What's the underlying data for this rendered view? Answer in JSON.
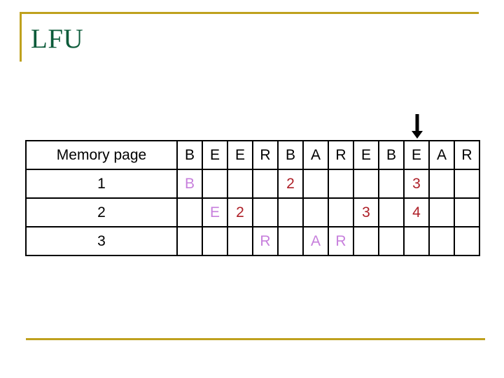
{
  "slide": {
    "title": "LFU",
    "accent_color": "#BFA11E",
    "title_color": "#0C5B3A",
    "reference_color": "#C77FDC",
    "count_color": "#AE1F27",
    "grid_color": "#000000",
    "background_color": "#FFFFFF"
  },
  "annotation": {
    "arrow_icon": "arrow-down-icon",
    "arrow_target_column_index": 9,
    "arrow_target_label": "E"
  },
  "table": {
    "row_label_header": "Memory page",
    "reference_string": [
      "B",
      "E",
      "E",
      "R",
      "B",
      "A",
      "R",
      "E",
      "B",
      "E",
      "A",
      "R"
    ],
    "rows": [
      {
        "label": "1",
        "cells": [
          "B",
          "",
          "",
          "",
          "2",
          "",
          "",
          "",
          "",
          "3",
          "",
          ""
        ],
        "kinds": [
          "ref",
          "empty",
          "empty",
          "empty",
          "count",
          "empty",
          "empty",
          "empty",
          "empty",
          "count",
          "empty",
          "empty"
        ]
      },
      {
        "label": "2",
        "cells": [
          "",
          "E",
          "2",
          "",
          "",
          "",
          "",
          "3",
          "",
          "4",
          "",
          ""
        ],
        "kinds": [
          "empty",
          "ref",
          "count",
          "empty",
          "empty",
          "empty",
          "empty",
          "count",
          "empty",
          "count",
          "empty",
          "empty"
        ]
      },
      {
        "label": "3",
        "cells": [
          "",
          "",
          "",
          "R",
          "",
          "A",
          "R",
          "",
          "",
          "",
          "",
          ""
        ],
        "kinds": [
          "empty",
          "empty",
          "empty",
          "ref",
          "empty",
          "ref",
          "ref",
          "empty",
          "empty",
          "empty",
          "empty",
          "empty"
        ]
      }
    ]
  }
}
